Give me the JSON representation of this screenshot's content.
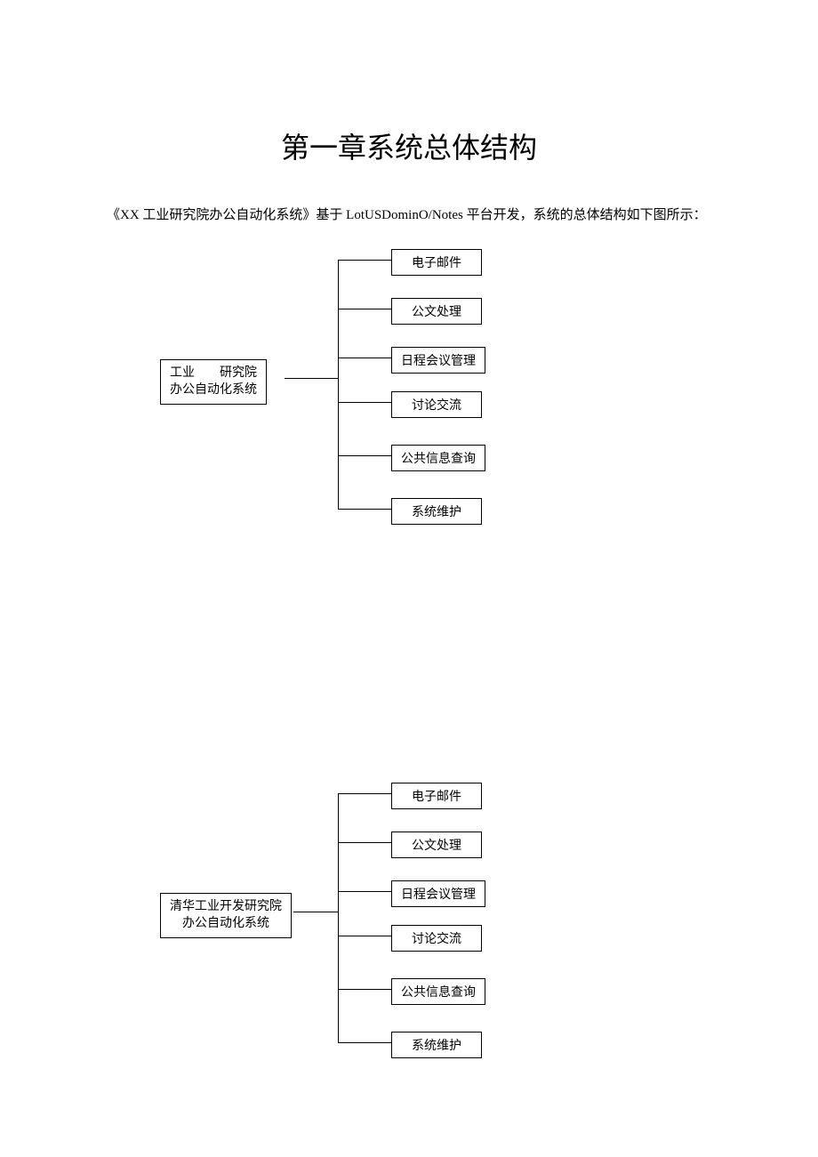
{
  "title": "第一章系统总体结构",
  "paragraph_prefix": "《XX 工业研究院办公自动化系统》基于 ",
  "platform": "LotUSDominO/Notes",
  "paragraph_suffix": " 平台开发，系统的总体结构如下图所示：",
  "diagram1": {
    "root_line1": "工业  研究院",
    "root_line2": "办公自动化系统",
    "children": [
      "电子邮件",
      "公文处理",
      "日程会议管理",
      "讨论交流",
      "公共信息查询",
      "系统维护"
    ]
  },
  "diagram2": {
    "root_line1": "清华工业开发研究院",
    "root_line2": "办公自动化系统",
    "children": [
      "电子邮件",
      "公文处理",
      "日程会议管理",
      "讨论交流",
      "公共信息查询",
      "系统维护"
    ]
  }
}
